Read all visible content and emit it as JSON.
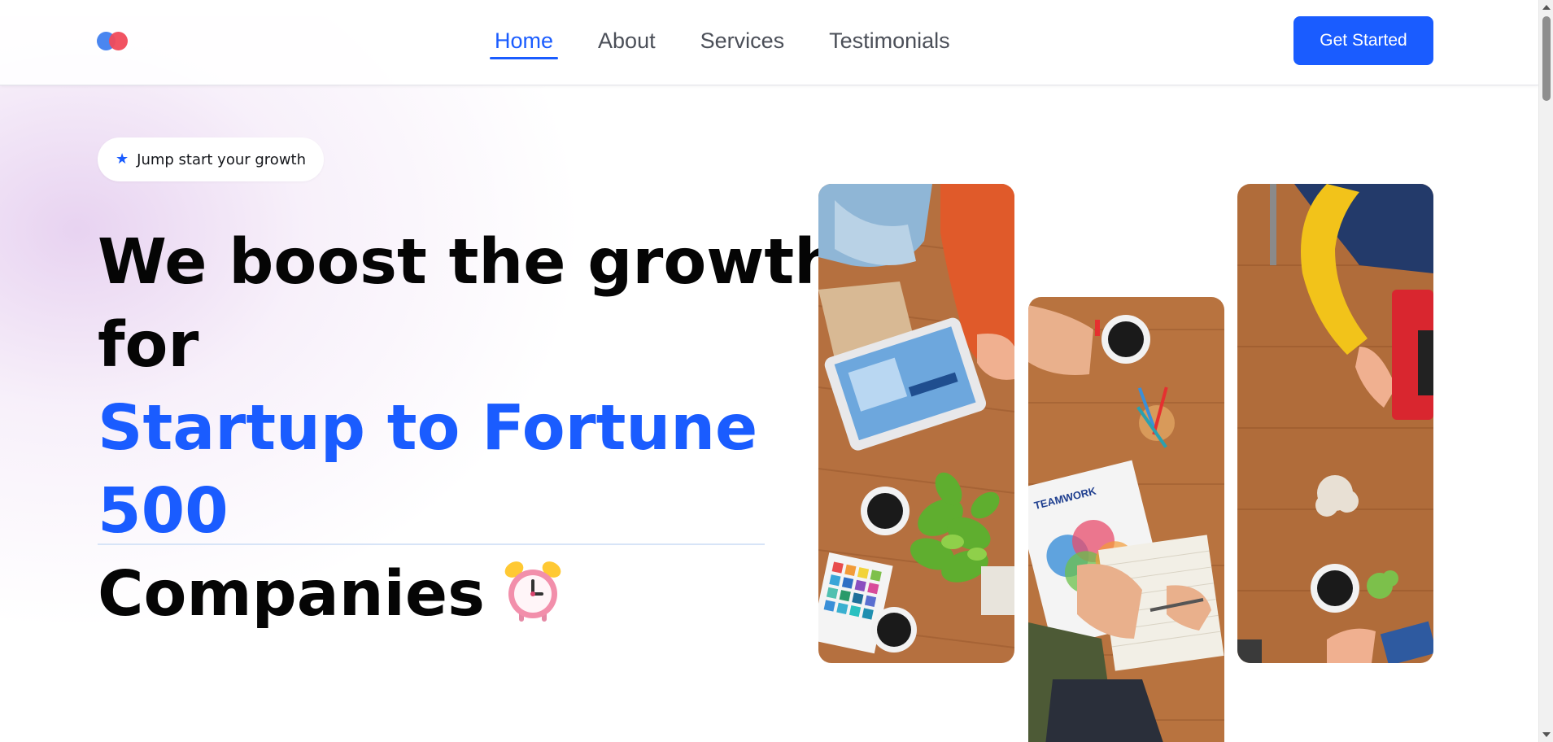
{
  "header": {
    "logo_icon": "two-overlapping-dots-logo",
    "nav": [
      {
        "label": "Home",
        "active": true
      },
      {
        "label": "About",
        "active": false
      },
      {
        "label": "Services",
        "active": false
      },
      {
        "label": "Testimonials",
        "active": false
      }
    ],
    "cta_label": "Get Started"
  },
  "hero": {
    "badge_icon": "star-icon",
    "badge_text": "Jump start your growth",
    "headline": {
      "line1": "We boost the growth",
      "line2": "for",
      "line3": "Startup to Fortune",
      "line4": "500",
      "line5": "Companies"
    },
    "headline_emoji": "alarm-clock-icon",
    "photos": [
      "team-desk-photo-left",
      "team-desk-photo-center",
      "team-desk-photo-right"
    ]
  },
  "colors": {
    "accent": "#1a5cff",
    "headline_text": "#050505",
    "nav_text": "#4b4f58",
    "logo_blue": "#4a86f0",
    "logo_red": "#f04a5a",
    "wood": "#b5703f"
  }
}
